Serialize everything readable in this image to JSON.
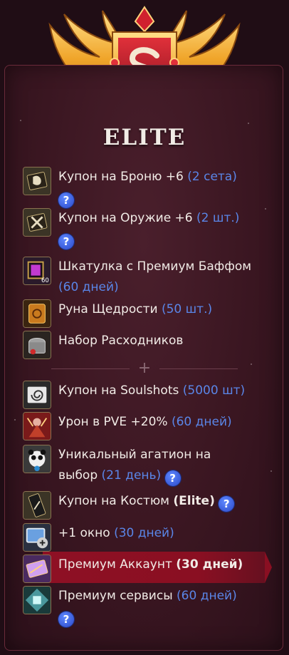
{
  "tier": {
    "title": "ELITE"
  },
  "colors": {
    "accent": "#5a86e8",
    "highlight_row": "#8e1024",
    "panel_bg": "#3a1621"
  },
  "items": [
    {
      "icon": "armor-coupon-icon",
      "name": "Купон на Броню +6",
      "detail": "(2 сета)",
      "help": "?"
    },
    {
      "icon": "weapon-coupon-icon",
      "name": "Купон на Оружие +6",
      "detail": "(2 шт.)",
      "help": "?"
    },
    {
      "icon": "premium-buff-box-icon",
      "name": "Шкатулка с Премиум Баффом",
      "detail": "(60 дней)",
      "badge": "60"
    },
    {
      "icon": "rune-icon",
      "name": "Руна Щедрости",
      "detail": "(50 шт.)"
    },
    {
      "icon": "consumables-chest-icon",
      "name": "Набор Расходников"
    },
    {
      "icon": "soulshot-coupon-icon",
      "name": "Купон на Soulshots",
      "detail": "(5000 шт)"
    },
    {
      "icon": "pve-damage-icon",
      "name": "Урон в PVE +20%",
      "detail": "(60 дней)"
    },
    {
      "icon": "agathion-icon",
      "name_line1": "Уникальный агатион на",
      "name_line2": "выбор",
      "detail": "(21 день)",
      "help": "?"
    },
    {
      "icon": "costume-coupon-icon",
      "name": "Купон на Костюм",
      "bold_detail": "(Elite)",
      "help": "?"
    },
    {
      "icon": "extra-window-icon",
      "name": "+1 окно",
      "detail": "(30 дней)"
    },
    {
      "icon": "premium-account-icon",
      "name": "Премиум Аккаунт",
      "bold_detail": "(30 дней)"
    },
    {
      "icon": "premium-services-icon",
      "name": "Премиум сервисы",
      "detail": "(60 дней)",
      "help": "?"
    }
  ],
  "divider": {
    "symbol": "+"
  }
}
